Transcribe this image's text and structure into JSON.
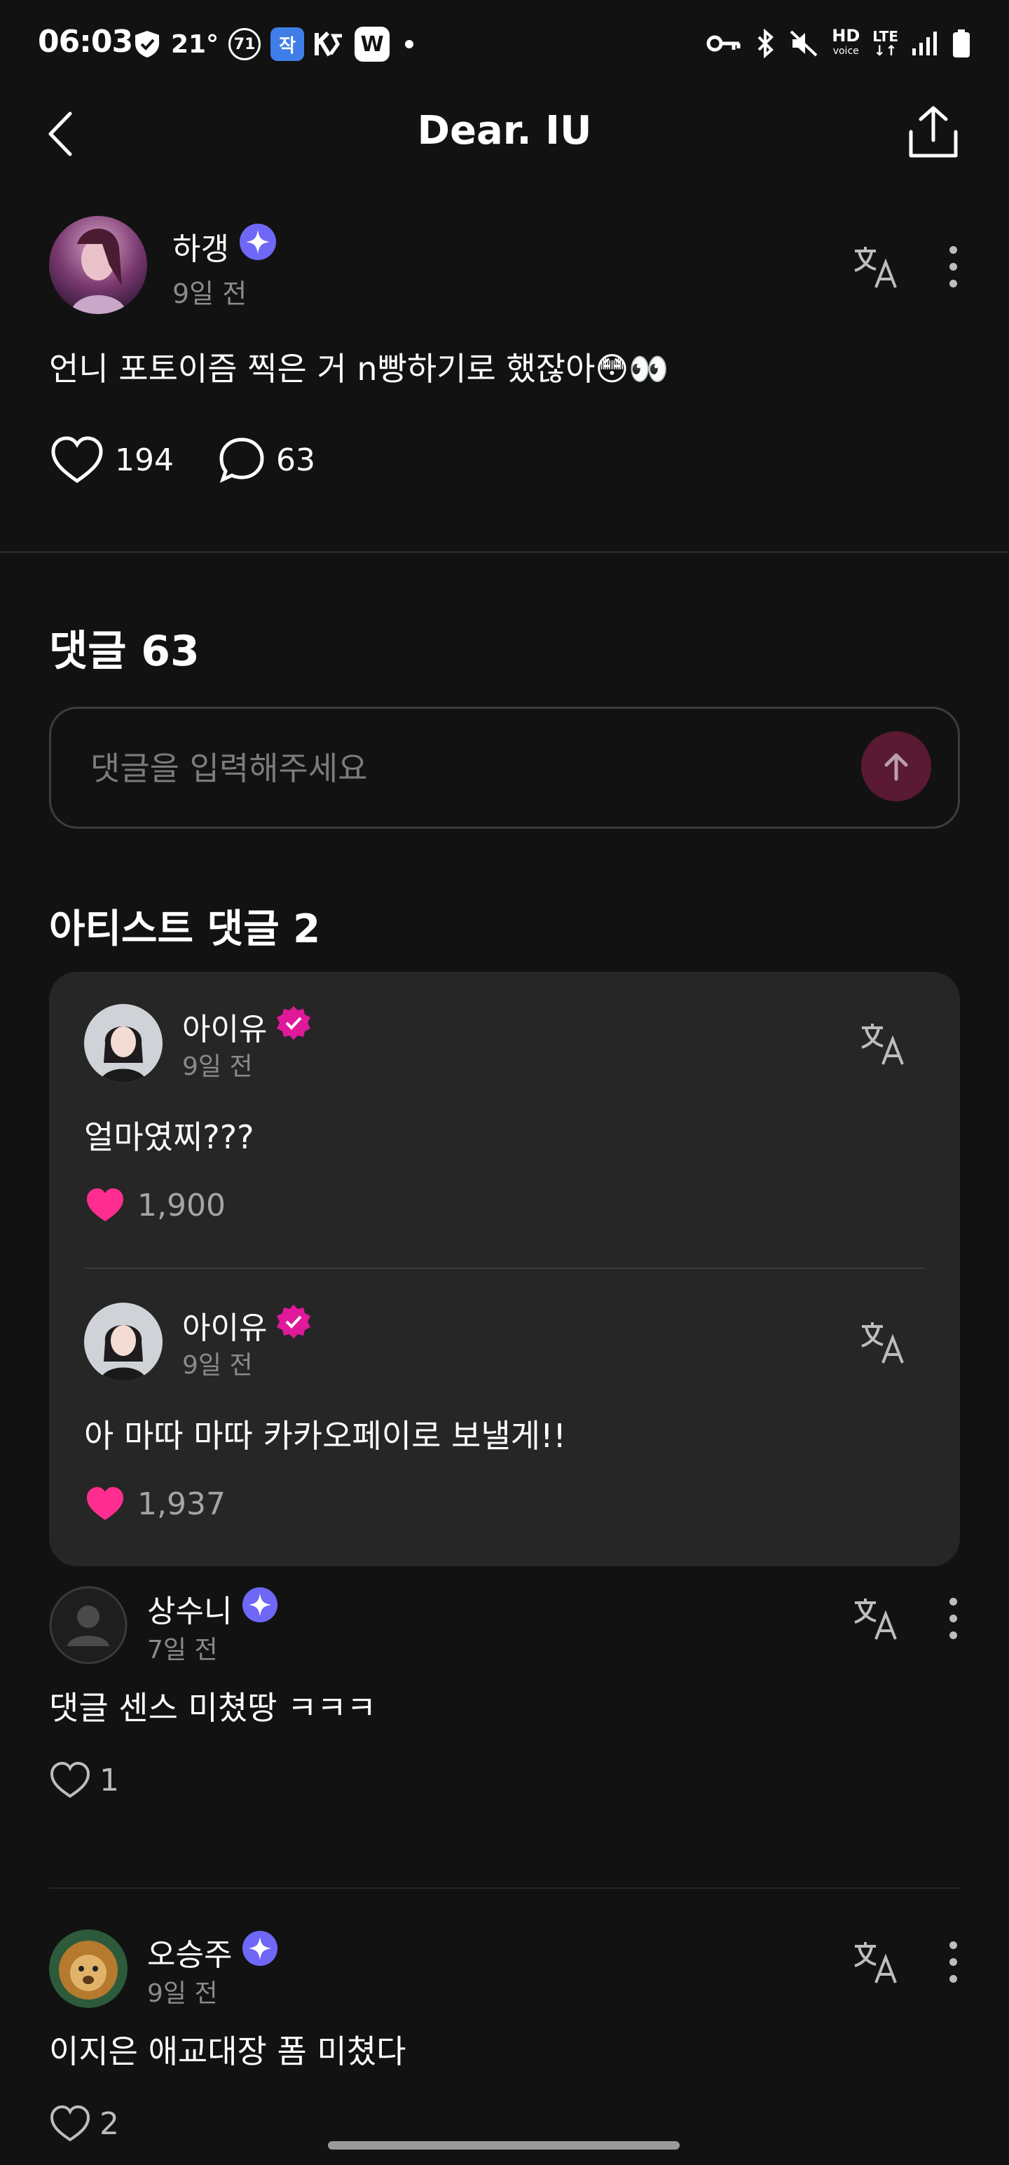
{
  "status_bar": {
    "time": "06:03",
    "temperature": "21°",
    "badge_count": "71",
    "app_label_blue": "작",
    "app_label_w": "W",
    "hd_label": "HD",
    "hd_sub": "voice",
    "lte_label": "LTE"
  },
  "header": {
    "title": "Dear. IU"
  },
  "post": {
    "author": "하갱",
    "time": "9일 전",
    "text": "언니 포토이즘 찍은 거 n빵하기로 했잖아😳👀",
    "likes": "194",
    "comments": "63"
  },
  "comments_section": {
    "title": "댓글 63",
    "input_placeholder": "댓글을 입력해주세요"
  },
  "artist_section": {
    "title": "아티스트 댓글 2",
    "comments": [
      {
        "author": "아이유",
        "time": "9일 전",
        "text": "얼마였찌???",
        "likes": "1,900"
      },
      {
        "author": "아이유",
        "time": "9일 전",
        "text": "아 마따 마따 카카오페이로 보낼게!!",
        "likes": "1,937"
      }
    ]
  },
  "comments": [
    {
      "author": "상수니",
      "time": "7일 전",
      "text": "댓글 센스 미쳤땅 ㅋㅋㅋ",
      "likes": "1"
    },
    {
      "author": "오승주",
      "time": "9일 전",
      "text": "이지은 애교대장 폼 미쳤다",
      "likes": "2"
    }
  ],
  "colors": {
    "background": "#121212",
    "card": "#262626",
    "member_badge": "#6f67f5",
    "artist_badge": "#e0199a",
    "like_pink": "#ff2d8f",
    "send_button": "#5a1a34"
  }
}
